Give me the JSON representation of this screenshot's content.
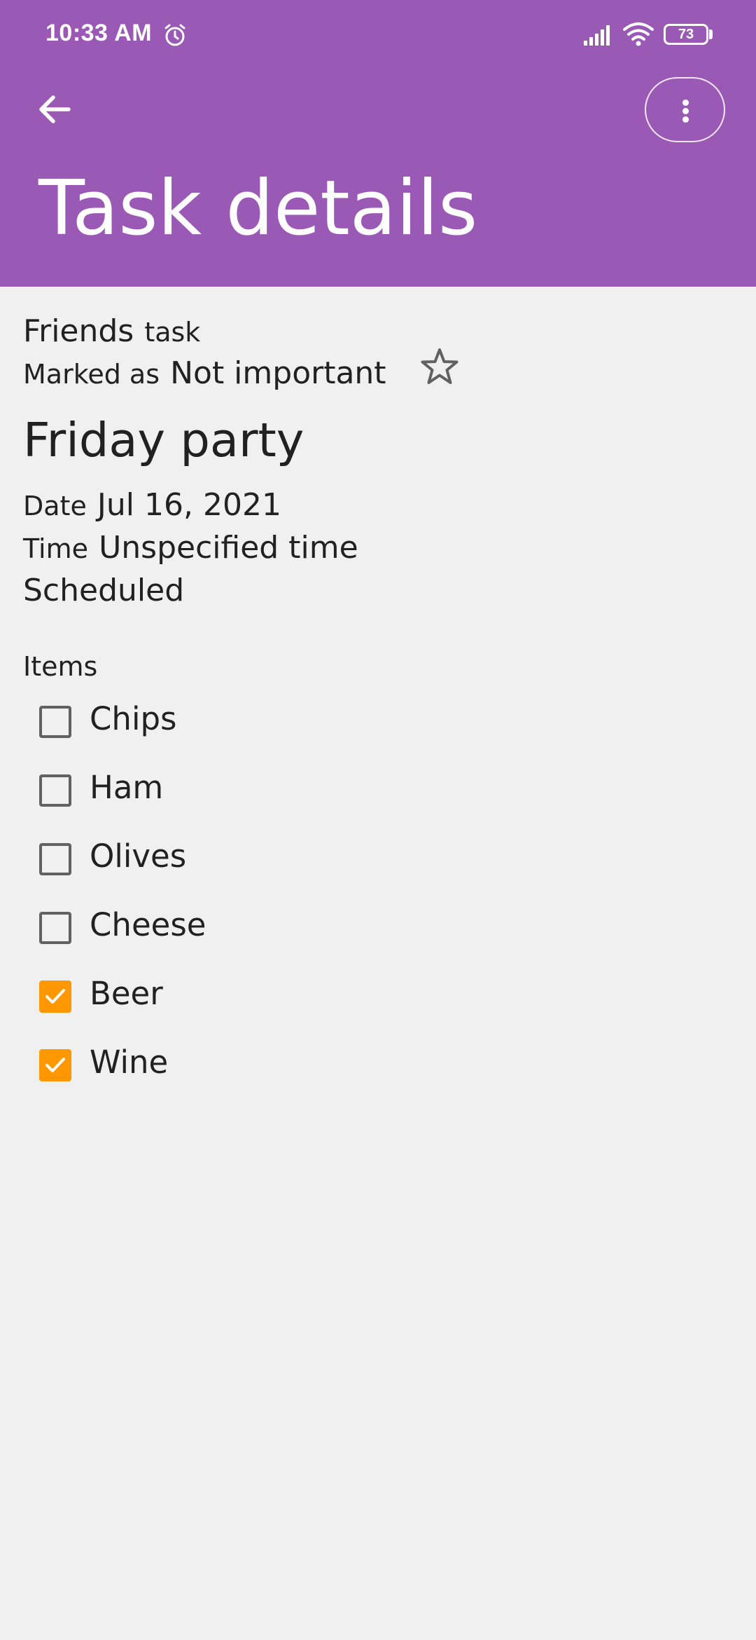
{
  "status_bar": {
    "time": "10:33 AM",
    "battery": "73",
    "icons": [
      "alarm-icon",
      "signal-icon",
      "wifi-icon",
      "battery-icon"
    ]
  },
  "app_bar": {
    "title": "Task details",
    "background_color": "#9b59b6",
    "icons": [
      "back-arrow-icon",
      "more-vert-icon"
    ]
  },
  "task": {
    "category_value": "Friends",
    "category_label": "task",
    "marked_label": "Marked as",
    "importance": "Not important",
    "star_icon": "star-outline-icon",
    "title": "Friday party",
    "date_label": "Date",
    "date_value": "Jul 16, 2021",
    "time_label": "Time",
    "time_value": "Unspecified time",
    "status": "Scheduled"
  },
  "items": {
    "label": "Items",
    "accent_color": "#ff9800",
    "list": [
      {
        "label": "Chips",
        "checked": false
      },
      {
        "label": "Ham",
        "checked": false
      },
      {
        "label": "Olives",
        "checked": false
      },
      {
        "label": "Cheese",
        "checked": false
      },
      {
        "label": "Beer",
        "checked": true
      },
      {
        "label": "Wine",
        "checked": true
      }
    ]
  }
}
